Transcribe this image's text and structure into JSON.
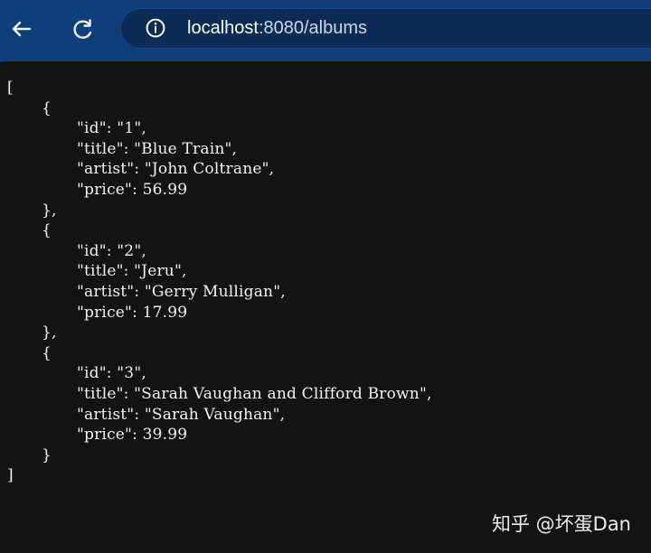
{
  "browser": {
    "back_icon": "back-arrow-icon",
    "reload_icon": "reload-icon",
    "info_icon": "info-icon",
    "url_host": "localhost",
    "url_path": ":8080/albums"
  },
  "json_text": {
    "open_bracket": "[",
    "open_brace_1": "{",
    "album_1_id": "\"id\": \"1\",",
    "album_1_title": "\"title\": \"Blue Train\",",
    "album_1_artist": "\"artist\": \"John Coltrane\",",
    "album_1_price": "\"price\": 56.99",
    "close_brace_1": "},",
    "open_brace_2": "{",
    "album_2_id": "\"id\": \"2\",",
    "album_2_title": "\"title\": \"Jeru\",",
    "album_2_artist": "\"artist\": \"Gerry Mulligan\",",
    "album_2_price": "\"price\": 17.99",
    "close_brace_2": "},",
    "open_brace_3": "{",
    "album_3_id": "\"id\": \"3\",",
    "album_3_title": "\"title\": \"Sarah Vaughan and Clifford Brown\",",
    "album_3_artist": "\"artist\": \"Sarah Vaughan\",",
    "album_3_price": "\"price\": 39.99",
    "close_brace_3": "}",
    "close_bracket": "]"
  },
  "watermark": "知乎 @坏蛋Dan",
  "colors": {
    "browser_top": "#0f3f7a",
    "address_bar": "#0c2b57",
    "page_background": "#131313",
    "text": "#f3f3f3"
  }
}
